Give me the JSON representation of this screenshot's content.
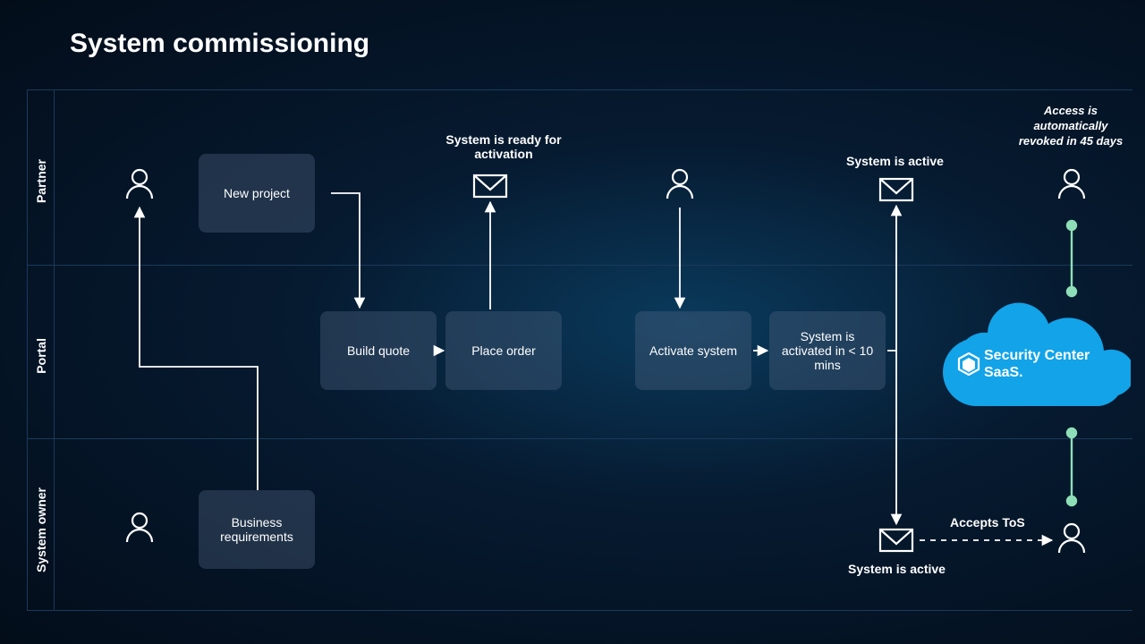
{
  "title": "System commissioning",
  "lanes": {
    "partner": "Partner",
    "portal": "Portal",
    "owner": "System owner"
  },
  "boxes": {
    "new_project": "New project",
    "build_quote": "Build quote",
    "place_order": "Place order",
    "business_req": "Business requirements",
    "activate_system": "Activate system",
    "system_activated": "System is activated in < 10 mins"
  },
  "captions": {
    "ready_activation": "System is ready for activation",
    "system_active_partner": "System is active",
    "system_active_owner": "System is active",
    "accepts_tos": "Accepts ToS",
    "access_revoked": "Access is automatically revoked in 45 days"
  },
  "cloud": {
    "line1": "Security Center",
    "line2": "SaaS."
  }
}
